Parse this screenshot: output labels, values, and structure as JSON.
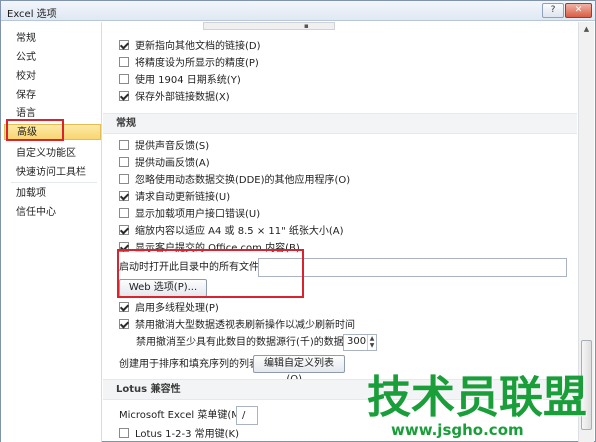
{
  "window": {
    "title": "Excel 选项",
    "help_label": "?",
    "close_label": "✕"
  },
  "sidebar": {
    "items": [
      {
        "label": "常规"
      },
      {
        "label": "公式"
      },
      {
        "label": "校对"
      },
      {
        "label": "保存"
      },
      {
        "label": "语言"
      },
      {
        "label": "高级",
        "active": true
      },
      {
        "label": "自定义功能区"
      },
      {
        "label": "快速访问工具栏"
      },
      {
        "label": "加载项"
      },
      {
        "label": "信任中心"
      }
    ]
  },
  "options_top": [
    {
      "label": "更新指向其他文档的链接(D)",
      "checked": true
    },
    {
      "label": "将精度设为所显示的精度(P)",
      "checked": false
    },
    {
      "label": "使用 1904 日期系统(Y)",
      "checked": false
    },
    {
      "label": "保存外部链接数据(X)",
      "checked": true
    }
  ],
  "general_section": {
    "heading": "常规",
    "options": [
      {
        "label": "提供声音反馈(S)",
        "checked": false
      },
      {
        "label": "提供动画反馈(A)",
        "checked": false
      },
      {
        "label": "忽略使用动态数据交换(DDE)的其他应用程序(O)",
        "checked": false
      },
      {
        "label": "请求自动更新链接(U)",
        "checked": true
      },
      {
        "label": "显示加载项用户接口错误(U)",
        "checked": false
      },
      {
        "label": "缩放内容以适应 A4 或 8.5 × 11\" 纸张大小(A)",
        "checked": true
      },
      {
        "label": "显示客户提交的 Office.com 内容(B)",
        "checked": true
      }
    ],
    "startup_label": "启动时打开此目录中的所有文件(L):",
    "startup_value": "",
    "web_options_button": "Web 选项(P)...",
    "multithread": {
      "label": "启用多线程处理(P)",
      "checked": true
    },
    "pivot_refresh": {
      "label": "禁用撤消大型数据透视表刷新操作以减少刷新时间",
      "checked": true
    },
    "pivot_rows_label": "禁用撤消至少具有此数目的数据源行(千)的数据透视表:",
    "pivot_rows_value": "300",
    "custom_list_label": "创建用于排序和填充序列的列表:",
    "custom_list_button": "编辑自定义列表(O)..."
  },
  "lotus_section": {
    "heading": "Lotus 兼容性",
    "menu_key_label": "Microsoft Excel 菜单键(M):",
    "menu_key_value": "/",
    "lotus_keys": {
      "label": "Lotus 1-2-3 常用键(K)",
      "checked": false
    }
  },
  "watermark": {
    "title": "技术员联盟",
    "url": "www.jsgho.com"
  },
  "colors": {
    "highlight_box": "#d9242f",
    "active_item": "#f8d671",
    "watermark": "#1a9e3a"
  }
}
